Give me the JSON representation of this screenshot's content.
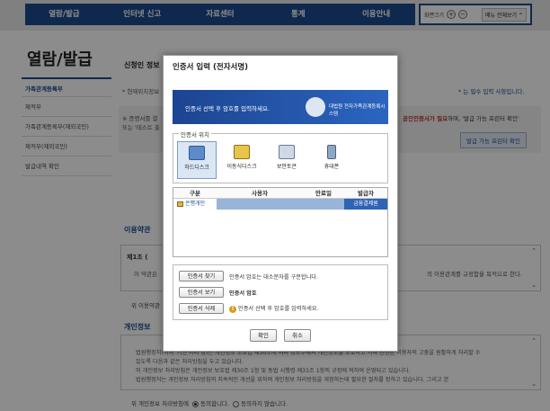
{
  "nav": {
    "items": [
      "열람/발급",
      "인터넷 신고",
      "자료센터",
      "통계",
      "이용안내"
    ],
    "screen_size_label": "화면크기",
    "zoom_in": "+",
    "zoom_out": "−",
    "menu_all_label": "메뉴 전체보기 ^"
  },
  "sidebar": {
    "title": "열람/발급",
    "items": [
      "가족관계등록부",
      "제적부",
      "가족관계등록부(재외국민)",
      "제적부(재외국민)",
      "발급내역 확인"
    ]
  },
  "content": {
    "title": "신청인 정보",
    "current_note": "* 현재위치정보",
    "required_note": "* 는 필수 입력 사항입니다.",
    "info_line1": "※ 증명서를 열",
    "info_line2": "또는 '테스트 출",
    "info_line3_prefix": "공인인증서가 필요",
    "info_line3_suffix": "하며, '발급 가능 프린터 확인'",
    "printer_check": "발급 가능 프린터 확인",
    "terms_section": "이용약관",
    "terms_article": "제1조 (",
    "terms_body": "이 약관은",
    "terms_body_right": "의 이용관계를 규정함을 목적으로 한다.",
    "terms_agree": "위 이용약관",
    "privacy_section": "개인정보",
    "privacy_lines": [
      "법원행정처(이하 '기관'이라 함)는 개인정보 보호법 제30조에 따라 정보주체의 개인정보를 보호하고 이와 관련한 이용자의 고충을 원활하게 처리할 수",
      "있도록 다음과 같은 처리방침을 두고 있습니다.",
      "이 개인정보 처리방침은 개인정보 보호법 제30조 1항 및 동법 시행령 제31조 1항의 규정에 의하여 운영되고 있습니다.",
      "법원행정처는 개인정보 처리방침의 지속적인 개선을 위하여 개인정보 처리방침을 개정하는데 필요한 절차를 정하고 있습니다. 그리고 본"
    ],
    "privacy_agree_prefix": "위 개인정보 처리방침에",
    "agree_yes": "동의합니다.",
    "agree_no": "동의하지 않습니다."
  },
  "modal": {
    "title": "인증서 입력 (전자서명)",
    "banner_text": "인증서 선택 후 암호를 입력하세요.",
    "banner_org": "대법원 전자가족관계등록시스템",
    "location_legend": "인증서 위치",
    "locations": [
      "하드디스크",
      "이동식디스크",
      "보안토큰",
      "휴대폰"
    ],
    "table_headers": [
      "구분",
      "사용자",
      "만료일",
      "발급자"
    ],
    "cert_row": {
      "type": "은행개인",
      "user": "",
      "expiry": "",
      "issuer": "금융결제원"
    },
    "find_button": "인증서 찾기",
    "find_note": "인증서 암호는 대소문자를 구분합니다.",
    "view_button": "인증서 보기",
    "password_label": "인증서 암호",
    "delete_button": "인증서 삭제",
    "warning_text": "인증서 선택 후 암호를 입력하세요.",
    "ok_button": "확인",
    "cancel_button": "취소"
  },
  "colors": {
    "nav_bg": "#1d4b8f",
    "selected_row": "#98b4d8",
    "issuer_cell": "#2e63b6"
  }
}
